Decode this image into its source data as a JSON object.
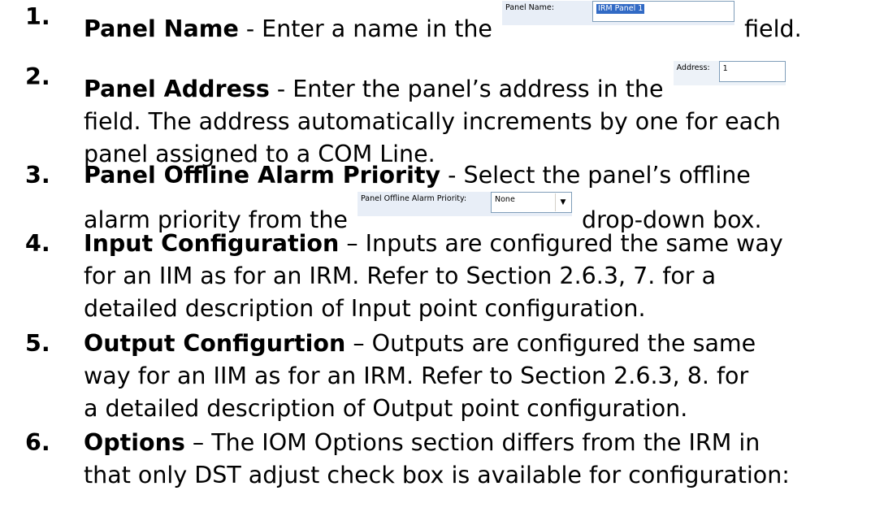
{
  "steps": [
    {
      "number": "1.",
      "title": "Panel Name",
      "text_before": " - Enter a name in the ",
      "control": {
        "label": "Panel Name:",
        "value": "IRM Panel 1"
      },
      "text_after": " field."
    },
    {
      "number": "2.",
      "title": "Panel Address",
      "text_before": " - Enter the panel’s address in the ",
      "control": {
        "label": "Address:",
        "value": "1"
      },
      "line2": "field.  The address automatically increments by one for each",
      "line3": "panel assigned to a COM Line."
    },
    {
      "number": "3.",
      "title": "Panel Offline Alarm Priority",
      "text_line1": " - Select the panel’s offline",
      "text_before": "alarm priority from the ",
      "control": {
        "label": "Panel Offline Alarm Priority:",
        "value": "None",
        "dropdown_icon": "chevron-down-icon"
      },
      "text_after": " drop-down box."
    },
    {
      "number": "4.",
      "title": "Input Configuration",
      "text_line1": " – Inputs are configured the same way",
      "line2": "for an IIM as for an IRM.  Refer to Section 2.6.3, 7. for a",
      "line3": "detailed description of Input point configuration."
    },
    {
      "number": "5.",
      "title": "Output Configurtion",
      "text_line1": " – Outputs are configured the same",
      "line2": "way for an IIM as for an IRM.  Refer to Section 2.6.3, 8. for",
      "line3": "a detailed description of Output point configuration."
    },
    {
      "number": "6.",
      "title": "Options",
      "text_line1": " – The IOM Options section differs from the IRM in",
      "line2": "that only DST adjust check box is available for configuration:"
    }
  ]
}
